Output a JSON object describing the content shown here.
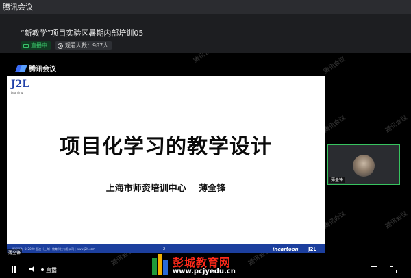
{
  "window": {
    "app_title": "腾讯会议"
  },
  "meeting": {
    "title": "“新教学”项目实验区暑期内部培训05",
    "live_badge": "直播中",
    "viewer_count": "观看人数：987人"
  },
  "stage": {
    "brand_logo_text": "腾讯会议",
    "watermark_text": "腾讯会议"
  },
  "slide": {
    "logo_text": "J2L",
    "logo_subtext": "Learning",
    "title": "项目化学习的教学设计",
    "subtitle": "上海市师资培训中心 薄全锋",
    "footer_copyright": "版权所有 © 2020 智途（上海）教育科技有限公司 | www.j2lt.com",
    "page_number": "2",
    "footer_brand": "incartoon",
    "footer_mini_logo": "J2L"
  },
  "speaker": {
    "name": "薄全锋"
  },
  "participant": {
    "name": "薄全锋"
  },
  "controls": {
    "live_label": "直播"
  },
  "site_watermark": {
    "name": "彭城教育网",
    "url": "www.pcjyedu.cn"
  },
  "colors": {
    "accent_green": "#37c35f",
    "footer_blue": "#1c3f9e",
    "site_red": "#ff2a1a"
  }
}
